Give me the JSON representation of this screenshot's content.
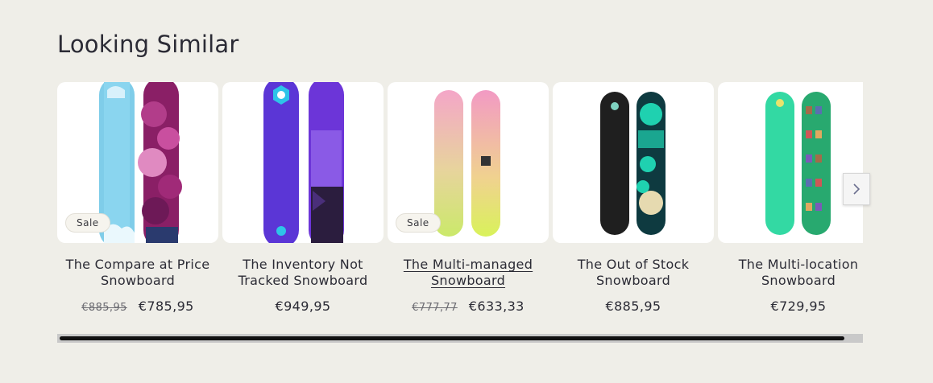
{
  "section": {
    "title": "Looking Similar"
  },
  "products": [
    {
      "name": "The Compare at Price Snowboard",
      "badge": "Sale",
      "compare_price": "€885,95",
      "price": "€785,95"
    },
    {
      "name": "The Inventory Not Tracked Snowboard",
      "badge": "",
      "compare_price": "",
      "price": "€949,95"
    },
    {
      "name": "The Multi-managed Snowboard",
      "badge": "Sale",
      "compare_price": "€777,77",
      "price": "€633,33"
    },
    {
      "name": "The Out of Stock Snowboard",
      "badge": "",
      "compare_price": "",
      "price": "€885,95"
    },
    {
      "name": "The Multi-location Snowboard",
      "badge": "",
      "compare_price": "",
      "price": "€729,95"
    }
  ],
  "icons": {
    "next": "chevron-right-icon"
  },
  "colors": {
    "background": "#efeee8",
    "text": "#2b2b35",
    "scrollbar": "#111111"
  }
}
